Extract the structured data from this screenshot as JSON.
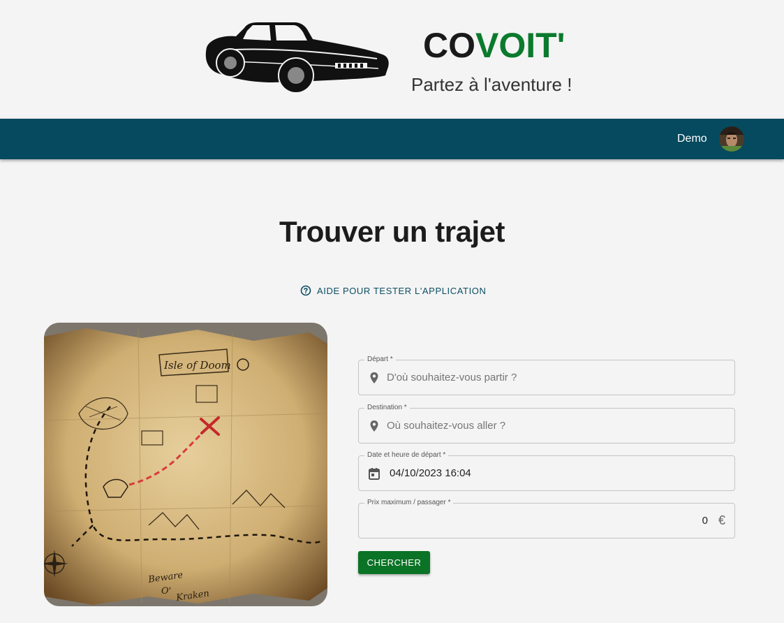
{
  "header": {
    "brand_part1": "CO",
    "brand_part2": "VOIT'",
    "tagline": "Partez à l'aventure !",
    "logo_icon": "car-icon"
  },
  "navbar": {
    "user_name": "Demo",
    "avatar_icon": "user-avatar"
  },
  "main": {
    "title": "Trouver un trajet",
    "help_link": "AIDE POUR TESTER L'APPLICATION",
    "help_icon": "help-circle-icon",
    "map_labels": {
      "isle": "Isle of Doom",
      "beware_1": "Beware",
      "beware_2": "O'",
      "beware_3": "Kraken"
    }
  },
  "form": {
    "departure": {
      "label": "Départ *",
      "placeholder": "D'où souhaitez-vous partir ?",
      "icon": "location-pin-icon"
    },
    "destination": {
      "label": "Destination *",
      "placeholder": "Où souhaitez-vous aller ?",
      "icon": "location-pin-icon"
    },
    "datetime": {
      "label": "Date et heure de départ *",
      "value": "04/10/2023 16:04",
      "icon": "calendar-icon"
    },
    "max_price": {
      "label": "Prix maximum / passager *",
      "value": "0",
      "currency": "€"
    },
    "search_button": "CHERCHER"
  },
  "colors": {
    "navbar": "#054a5e",
    "brand_green": "#0b7a2d",
    "button_green": "#0b7326",
    "link": "#0a4d63",
    "map_route": "#d83a3a"
  }
}
